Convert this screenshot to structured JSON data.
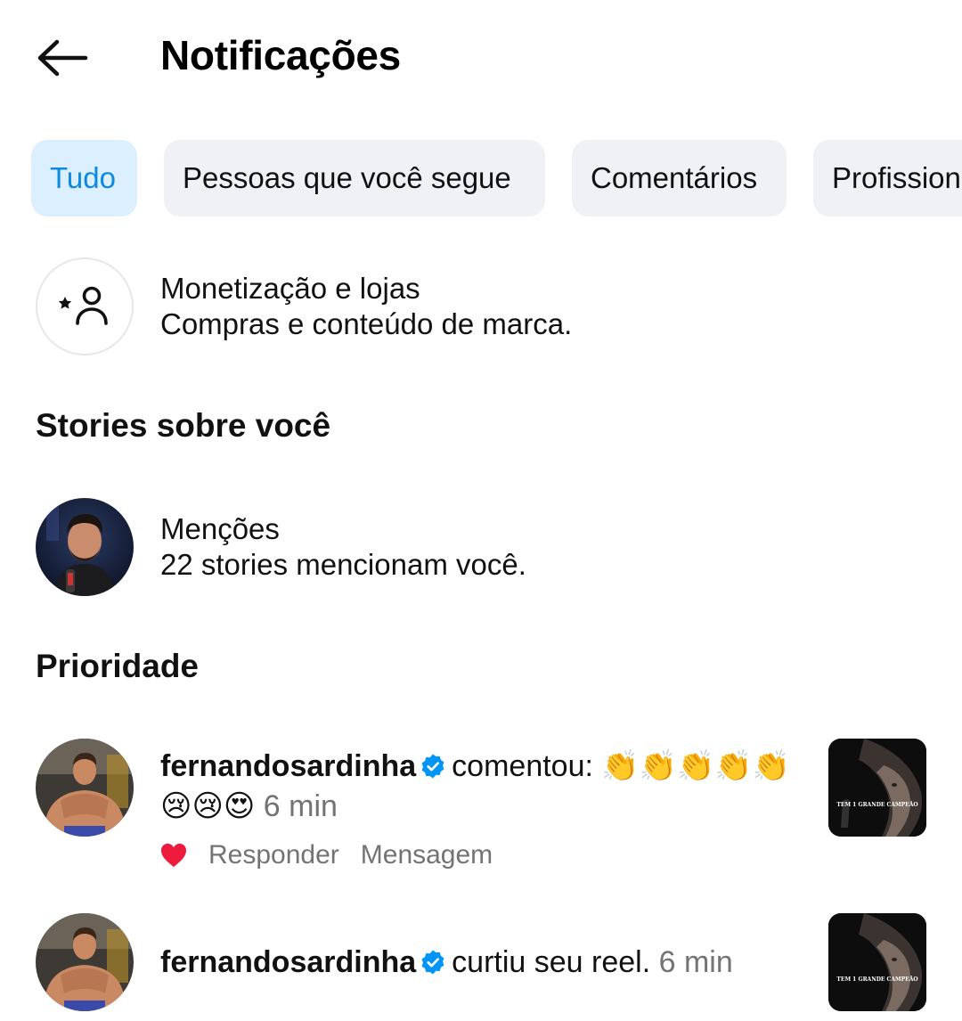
{
  "header": {
    "title": "Notificações"
  },
  "tabs": [
    {
      "label": "Tudo",
      "active": true
    },
    {
      "label": "Pessoas que você segue",
      "active": false
    },
    {
      "label": "Comentários",
      "active": false
    },
    {
      "label": "Profissional",
      "active": false
    }
  ],
  "monetization": {
    "title": "Monetização e lojas",
    "subtitle": "Compras e conteúdo de marca.",
    "icon": "person-star-icon"
  },
  "stories_section": {
    "title": "Stories sobre você",
    "mentions_title": "Menções",
    "mentions_subtitle": "22 stories mencionam você."
  },
  "priority_section": {
    "title": "Prioridade"
  },
  "notifications": [
    {
      "username": "fernandosardinha",
      "verified": true,
      "action": "comentou:",
      "comment_line1": "👏👏👏👏👏",
      "comment_line2": "😢😢😍",
      "time": "6 min",
      "actions": [
        "Responder",
        "Mensagem"
      ],
      "liked": true,
      "thumb_caption": "TEM 1 GRANDE CAMPEÃO"
    },
    {
      "username": "fernandosardinha",
      "verified": true,
      "action": "curtiu seu reel.",
      "time": "6 min",
      "thumb_caption": "TEM 1 GRANDE CAMPEÃO"
    }
  ],
  "colors": {
    "accent": "#0a8ae0",
    "active_tab_bg": "#dcefff",
    "tab_bg": "#eff1f4",
    "verified_blue": "#0095f6",
    "heart_red": "#ed1b3c",
    "muted_text": "#737373"
  }
}
